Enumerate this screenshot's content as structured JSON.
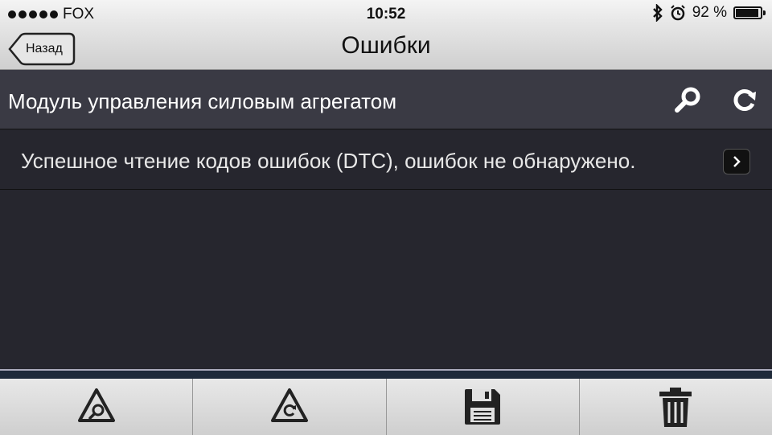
{
  "status": {
    "carrier": "FOX",
    "time": "10:52",
    "battery": "92 %",
    "battery_level": 0.92
  },
  "nav": {
    "back_label": "Назад",
    "title": "Ошибки"
  },
  "section": {
    "title": "Модуль управления силовым агрегатом"
  },
  "rows": [
    {
      "text": "Успешное чтение кодов ошибок (DTC), ошибок не обнаружено."
    }
  ],
  "toolbar": {
    "items": [
      {
        "icon": "warning-search-icon"
      },
      {
        "icon": "warning-refresh-icon"
      },
      {
        "icon": "save-icon"
      },
      {
        "icon": "trash-icon"
      }
    ]
  },
  "colors": {
    "background": "#26262e",
    "section": "#3a3a44",
    "navbar": "#e4e4e4"
  }
}
